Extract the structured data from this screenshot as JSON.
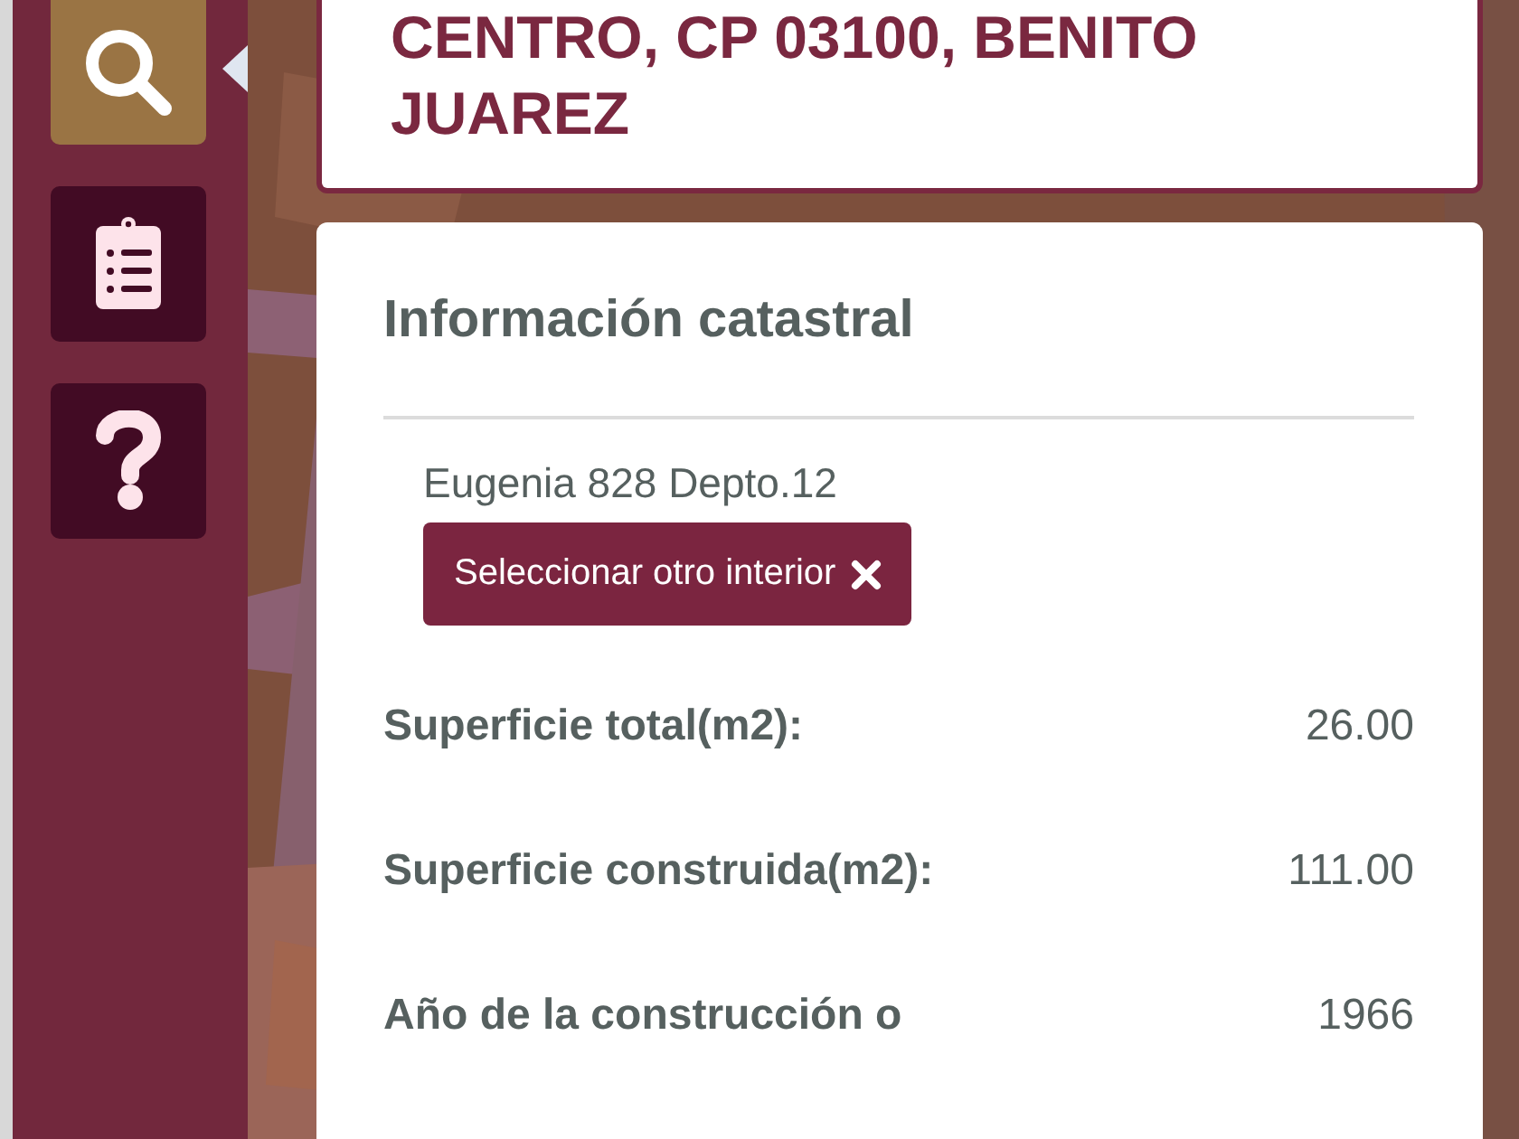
{
  "sidebar": {
    "items": [
      {
        "kind": "search",
        "selected": true
      },
      {
        "kind": "clipboard",
        "selected": false
      },
      {
        "kind": "help",
        "selected": false
      }
    ]
  },
  "address": {
    "title": "CENTRO, CP 03100, BENITO JUAREZ"
  },
  "info": {
    "title": "Información catastral",
    "unit": "Eugenia 828 Depto.12",
    "button": "Seleccionar otro interior",
    "rows": [
      {
        "label": "Superficie total(m2):",
        "value": "26.00"
      },
      {
        "label": "Superficie construida(m2):",
        "value": "111.00"
      },
      {
        "label": "Año de la construcción o",
        "value": "1966"
      }
    ]
  }
}
